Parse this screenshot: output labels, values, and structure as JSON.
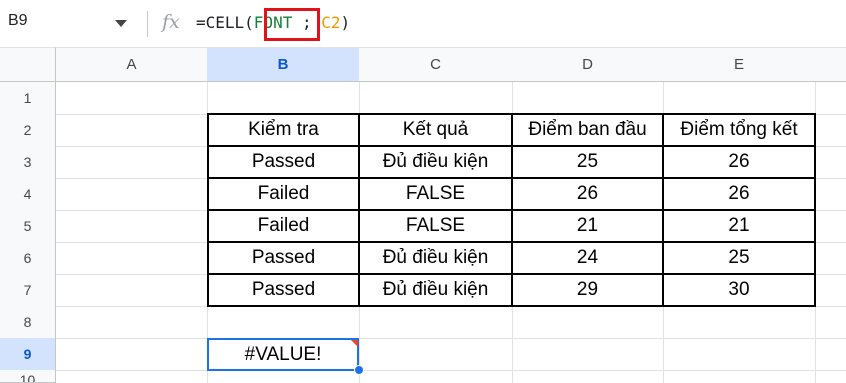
{
  "formula_bar": {
    "cell_reference": "B9",
    "fx_label": "fx",
    "formula_prefix": "=CELL(",
    "formula_arg_info_type": "FONT",
    "formula_separator": " ; ",
    "formula_arg_reference": "C2",
    "formula_suffix": ")"
  },
  "columns": [
    "A",
    "B",
    "C",
    "D",
    "E"
  ],
  "selected_column": "B",
  "rows": [
    "1",
    "2",
    "3",
    "4",
    "5",
    "6",
    "7",
    "8",
    "9",
    "10"
  ],
  "selected_row": "9",
  "table": {
    "headers": [
      "Kiểm tra",
      "Kết quả",
      "Điểm ban đầu",
      "Điểm tổng kết"
    ],
    "rows": [
      [
        "Passed",
        "Đủ điều kiện",
        "25",
        "26"
      ],
      [
        "Failed",
        "FALSE",
        "26",
        "26"
      ],
      [
        "Failed",
        "FALSE",
        "21",
        "21"
      ],
      [
        "Passed",
        "Đủ điều kiện",
        "24",
        "25"
      ],
      [
        "Passed",
        "Đủ điều kiện",
        "29",
        "30"
      ]
    ]
  },
  "result_cell": {
    "address": "B9",
    "value": "#VALUE!"
  },
  "colors": {
    "selection_blue": "#1a73e8",
    "header_selected_bg": "#d3e3fd",
    "highlight_red": "#e0121a",
    "formula_green": "#188038",
    "formula_orange": "#f29900",
    "error_flag_red": "#ea4335"
  }
}
